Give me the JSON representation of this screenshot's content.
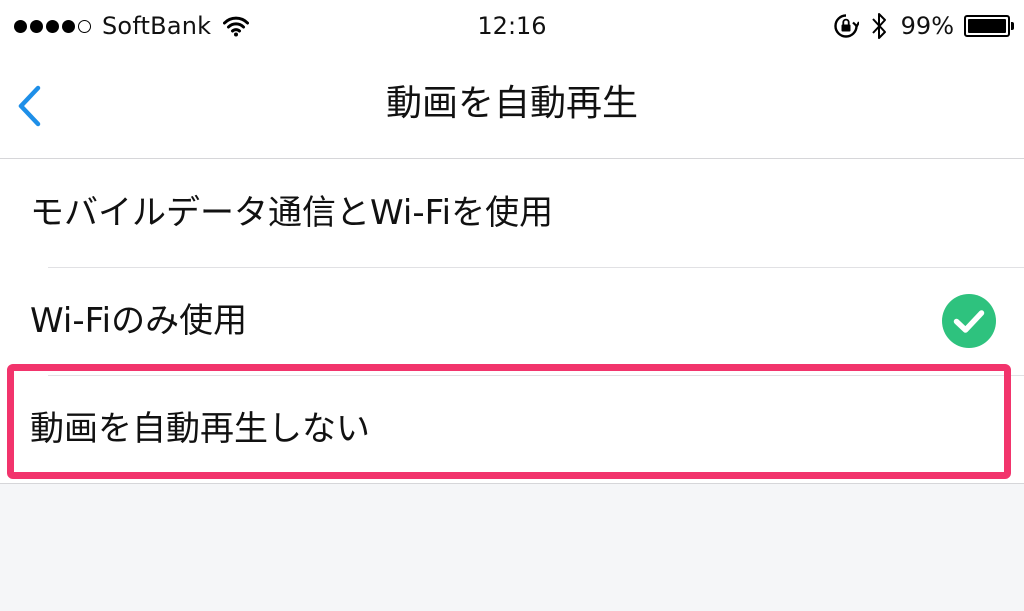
{
  "status_bar": {
    "signal_bars_filled": 4,
    "signal_bars_total": 5,
    "carrier": "SoftBank",
    "time": "12:16",
    "battery_percent": "99%",
    "battery_level": 0.99,
    "icons": [
      "wifi-icon",
      "orientation-lock-icon",
      "bluetooth-icon",
      "battery-icon"
    ]
  },
  "nav": {
    "back_icon": "chevron-left-icon",
    "title": "動画を自動再生"
  },
  "options": [
    {
      "label": "モバイルデータ通信とWi-Fiを使用",
      "selected": false
    },
    {
      "label": "Wi-Fiのみ使用",
      "selected": true
    },
    {
      "label": "動画を自動再生しない",
      "selected": false,
      "highlighted": true
    }
  ],
  "colors": {
    "accent": "#1e8fe8",
    "check": "#2ec27e",
    "highlight": "#f2346c",
    "background": "#f5f6f8"
  }
}
